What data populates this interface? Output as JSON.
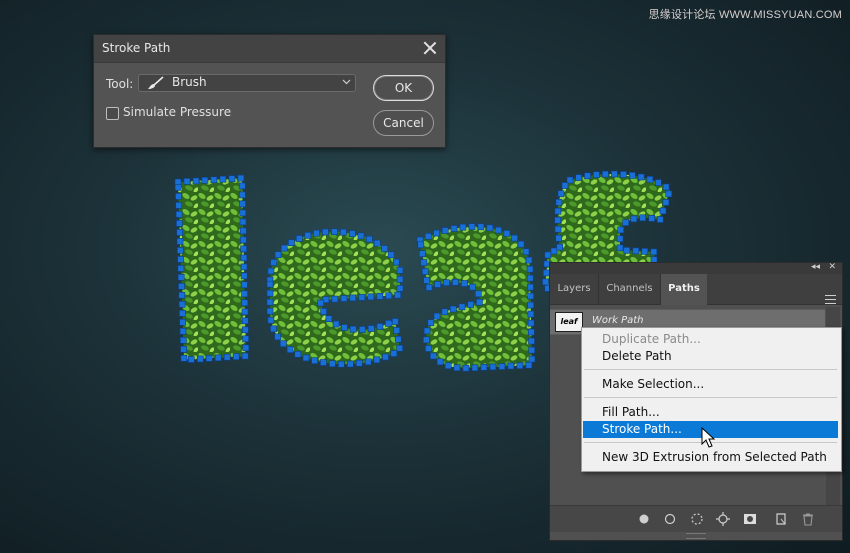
{
  "watermark": "思缘设计论坛 WWW.MISSYUAN.COM",
  "dialog": {
    "title": "Stroke Path",
    "tool_label": "Tool:",
    "tool_value": "Brush",
    "simulate_pressure_label": "Simulate Pressure",
    "simulate_pressure_checked": false,
    "ok_label": "OK",
    "cancel_label": "Cancel"
  },
  "artwork": {
    "text": "leaf",
    "leaf_color": "#4f9a2c",
    "anchor_color": "#1a6fd6"
  },
  "panel": {
    "tabs": [
      {
        "label": "Layers",
        "active": false
      },
      {
        "label": "Channels",
        "active": false
      },
      {
        "label": "Paths",
        "active": true
      }
    ],
    "path_row": {
      "thumb_text": "leaf",
      "name": "Work Path"
    },
    "bottom_icons": [
      "fill-path-icon",
      "stroke-path-icon",
      "load-selection-icon",
      "make-work-path-icon",
      "add-mask-icon",
      "new-path-icon",
      "delete-icon"
    ]
  },
  "context_menu": {
    "items": [
      {
        "label": "Duplicate Path...",
        "disabled": true
      },
      {
        "label": "Delete Path",
        "disabled": false
      },
      {
        "label": "Make Selection...",
        "disabled": false
      },
      {
        "label": "Fill Path...",
        "disabled": false
      },
      {
        "label": "Stroke Path...",
        "disabled": false,
        "highlighted": true
      },
      {
        "label": "New 3D Extrusion from Selected Path",
        "disabled": false
      }
    ],
    "highlight_color": "#0a7ad6"
  }
}
